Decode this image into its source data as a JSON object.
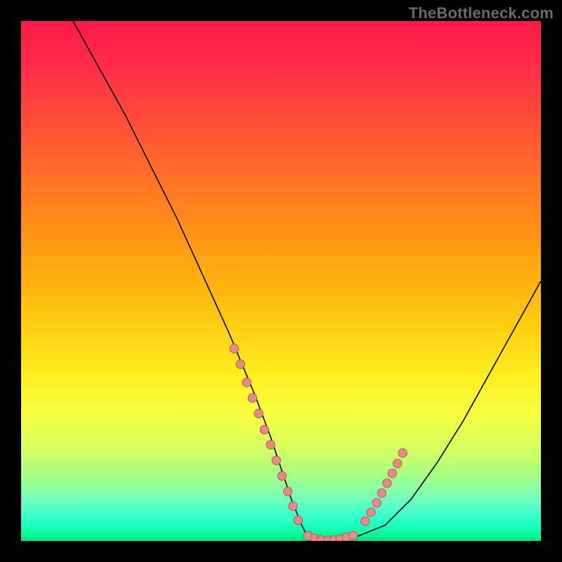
{
  "watermark": "TheBottleneck.com",
  "colors": {
    "curve_stroke": "#000000",
    "dot_fill": "#e48a88",
    "dot_stroke": "#b55a55"
  },
  "chart_data": {
    "type": "line",
    "title": "",
    "xlabel": "",
    "ylabel": "",
    "xlim": [
      0,
      100
    ],
    "ylim": [
      0,
      100
    ],
    "grid": false,
    "series": [
      {
        "name": "bottleneck-curve",
        "x": [
          10,
          15,
          20,
          25,
          30,
          35,
          40,
          45,
          48,
          50,
          52,
          54,
          55,
          58,
          60,
          62,
          65,
          70,
          75,
          80,
          85,
          90,
          95,
          100
        ],
        "y": [
          100,
          91,
          82,
          72,
          62,
          51,
          40,
          28,
          20,
          14,
          8,
          3,
          1,
          0,
          0,
          0.5,
          1,
          3,
          8,
          15,
          23,
          32,
          41,
          50
        ]
      }
    ],
    "dot_clusters": [
      {
        "name": "left-arm",
        "points": [
          {
            "x": 41,
            "y": 37
          },
          {
            "x": 42.2,
            "y": 34
          },
          {
            "x": 43.4,
            "y": 30.5
          },
          {
            "x": 44.5,
            "y": 27.5
          },
          {
            "x": 45.7,
            "y": 24.5
          },
          {
            "x": 46.8,
            "y": 21.4
          },
          {
            "x": 48.0,
            "y": 18.5
          },
          {
            "x": 49.1,
            "y": 15.5
          },
          {
            "x": 50.2,
            "y": 12.5
          },
          {
            "x": 51.3,
            "y": 9.5
          },
          {
            "x": 52.3,
            "y": 6.7
          },
          {
            "x": 53.3,
            "y": 4.0
          }
        ]
      },
      {
        "name": "valley",
        "points": [
          {
            "x": 55.2,
            "y": 1.0
          },
          {
            "x": 56.5,
            "y": 0.5
          },
          {
            "x": 57.7,
            "y": 0.2
          },
          {
            "x": 59.0,
            "y": 0.1
          },
          {
            "x": 60.2,
            "y": 0.2
          },
          {
            "x": 61.4,
            "y": 0.4
          },
          {
            "x": 62.6,
            "y": 0.7
          },
          {
            "x": 63.9,
            "y": 1.0
          }
        ]
      },
      {
        "name": "right-arm",
        "points": [
          {
            "x": 66.2,
            "y": 3.8
          },
          {
            "x": 67.3,
            "y": 5.5
          },
          {
            "x": 68.4,
            "y": 7.3
          },
          {
            "x": 69.4,
            "y": 9.2
          },
          {
            "x": 70.4,
            "y": 11.1
          },
          {
            "x": 71.4,
            "y": 13.0
          },
          {
            "x": 72.4,
            "y": 14.9
          },
          {
            "x": 73.4,
            "y": 16.9
          }
        ]
      }
    ]
  }
}
